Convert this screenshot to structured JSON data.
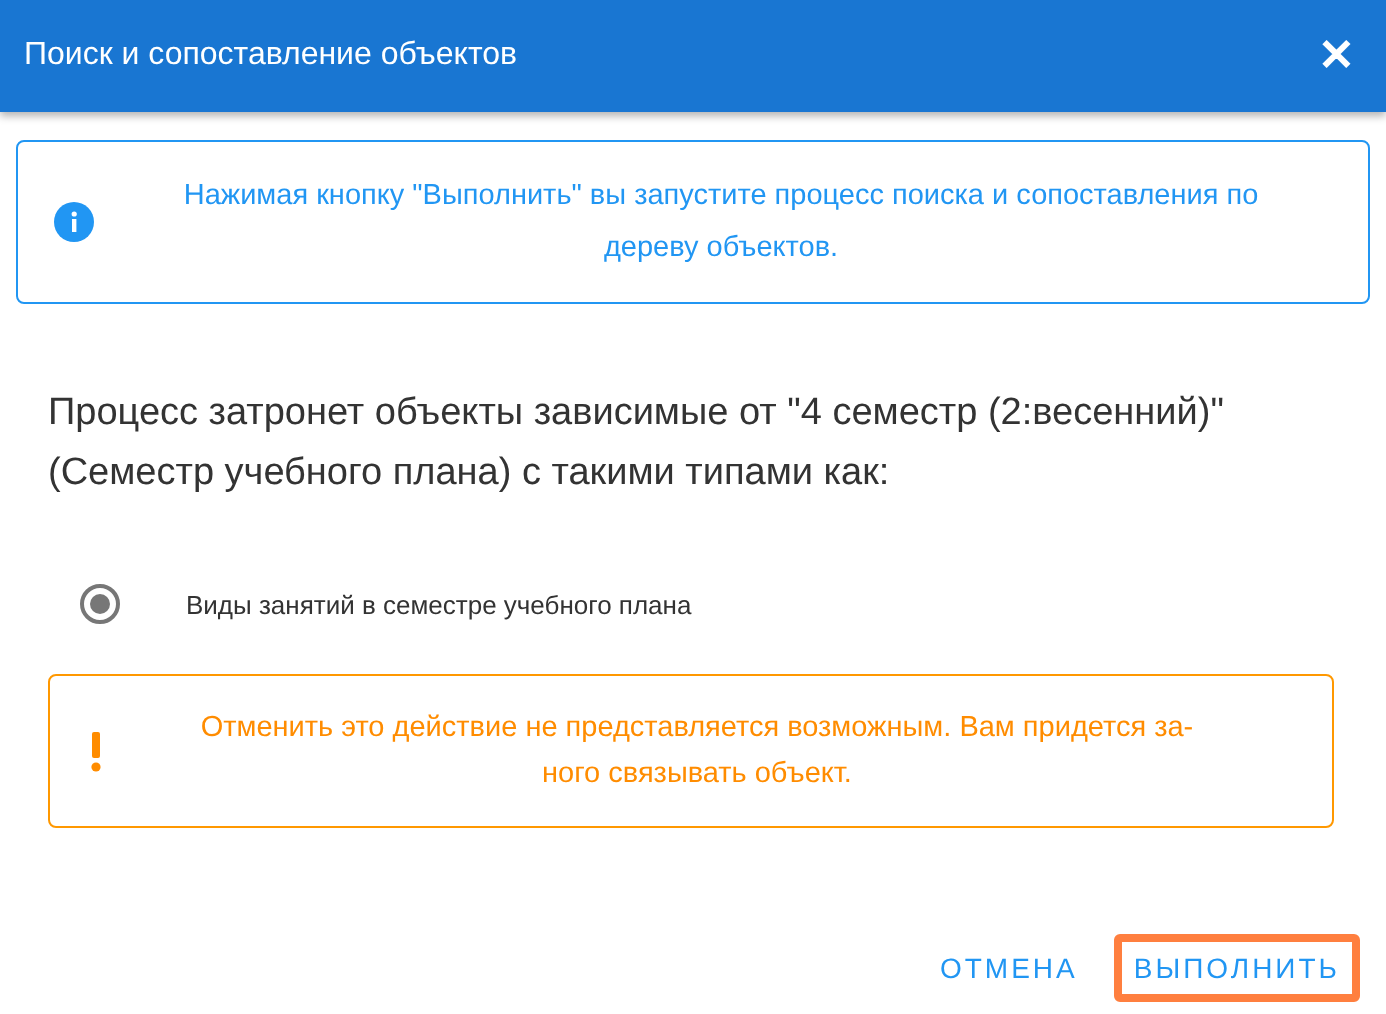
{
  "dialog": {
    "title": "Поиск и сопоставление объектов",
    "close": "✕"
  },
  "info": {
    "text": "Нажимая кнопку \"Выполнить\" вы запустите процесс поиска и сопоставления по дереву объектов."
  },
  "description": "Процесс затронет объекты зависимые от \"4 семестр (2:весенний)\" (Семестр учебного плана) с такими типами как:",
  "options": [
    {
      "label": "Виды занятий в семестре учебного плана",
      "selected": true
    }
  ],
  "warning": {
    "text": "Отменить это действие не представляется возможным. Вам придется за-\nного связывать объект."
  },
  "buttons": [
    {
      "label": "ОТМЕНА",
      "focused": false
    },
    {
      "label": "ВЫПОЛНИТЬ",
      "focused": true
    }
  ]
}
